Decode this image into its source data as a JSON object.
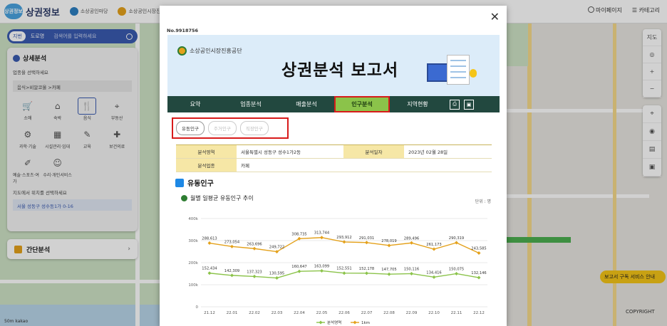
{
  "topbar": {
    "logo_badge": "상권정보",
    "logo_text": "상권정보",
    "partner1": "소상공인마당",
    "partner2": "소상공인시장진흥공단",
    "mypage": "마이페이지",
    "cart": "카테고리"
  },
  "search": {
    "seg1": "지번",
    "seg2": "도로명",
    "placeholder": "검색어를 입력하세요"
  },
  "panel": {
    "title": "상세분석",
    "hint": "업종을 선택하세요",
    "crumb": "음식>비알코올 >카페",
    "items": [
      {
        "label": "소매",
        "icon": "cart-icon",
        "glyph": "🛒"
      },
      {
        "label": "숙박",
        "icon": "house-icon",
        "glyph": "⌂"
      },
      {
        "label": "음식",
        "icon": "fork-knife-icon",
        "glyph": "🍴"
      },
      {
        "label": "부동산",
        "icon": "pin-icon",
        "glyph": "⌖"
      },
      {
        "label": "과학·기술",
        "icon": "gear-icon",
        "glyph": "⚙"
      },
      {
        "label": "시설관리·임대",
        "icon": "building-icon",
        "glyph": "▦"
      },
      {
        "label": "교육",
        "icon": "book-icon",
        "glyph": "✎"
      },
      {
        "label": "보건의료",
        "icon": "health-icon",
        "glyph": "✚"
      },
      {
        "label": "예술·스포츠·여가",
        "icon": "brush-icon",
        "glyph": "✐"
      },
      {
        "label": "수리·개인서비스",
        "icon": "person-icon",
        "glyph": "☺"
      }
    ],
    "hint2": "지도에서 위치를 선택하세요",
    "location": "서울 성동구 성수동1가 0-16"
  },
  "simple": {
    "label": "간단분석"
  },
  "map_tools": {
    "label_top": "지도"
  },
  "promo": "보고서 구독 서비스 안내",
  "copyright": "COPYRIGHT",
  "scale": "50m kakao",
  "modal": {
    "docno": "No.9918756",
    "org": "소상공인시장진흥공단",
    "title": "상권분석 보고서",
    "tabs": [
      "요약",
      "업종분석",
      "매출분석",
      "인구분석",
      "지역현황"
    ],
    "active_tab": "인구분석",
    "subtabs": [
      "유동인구",
      "주거인구",
      "직장인구"
    ],
    "info": {
      "area_label": "분석영역",
      "area_value": "서울특별시 성동구 성수1가2동",
      "date_label": "분석일자",
      "date_value": "2023년 02월 28일",
      "industry_label": "분석업종",
      "industry_value": "카페"
    },
    "section_title": "유동인구",
    "chart_title": "월별 일평균 유동인구 추이",
    "unit": "단위 : 명"
  },
  "chart_data": {
    "type": "line",
    "title": "월별 일평균 유동인구 추이",
    "categories": [
      "21.12",
      "22.01",
      "22.02",
      "22.03",
      "22.04",
      "22.05",
      "22.06",
      "22.07",
      "22.08",
      "22.09",
      "22.10",
      "22.11",
      "22.12"
    ],
    "y_ticks": [
      "0",
      "100k",
      "200k",
      "300k",
      "400k"
    ],
    "ylim": [
      0,
      400000
    ],
    "series": [
      {
        "name": "분석영역",
        "color": "#8bc34a",
        "values": [
          152434,
          142309,
          137323,
          130595,
          160647,
          163099,
          152551,
          152178,
          147705,
          150116,
          134416,
          150075,
          132146
        ],
        "labels": [
          "152,434",
          "142,309",
          "137,323",
          "130,595",
          "160,647",
          "163,099",
          "152,551",
          "152,178",
          "147,705",
          "150,116",
          "134,416",
          "150,075",
          "132,146"
        ]
      },
      {
        "name": "1km",
        "color": "#e4a11b",
        "values": [
          288613,
          273054,
          263696,
          249722,
          308735,
          313744,
          293912,
          291031,
          278019,
          289496,
          261173,
          290319,
          243585
        ],
        "labels": [
          "288,613",
          "273,054",
          "263,696",
          "249,722",
          "308,735",
          "313,744",
          "293,912",
          "291,031",
          "278,019",
          "289,496",
          "261,173",
          "290,319",
          "243,585"
        ]
      }
    ]
  }
}
